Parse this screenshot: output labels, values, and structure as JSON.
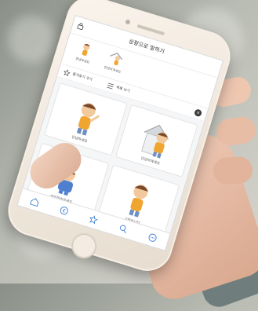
{
  "app": {
    "title": "상황으로 말하기",
    "icons": {
      "lock": "lock-icon",
      "close": "close-icon"
    }
  },
  "favorites": [
    {
      "label": "안녕하세요",
      "icon": "boy-greeting-icon"
    },
    {
      "label": "안녕히계세요",
      "icon": "boy-house-icon"
    }
  ],
  "actions": {
    "add_favorite": "즐겨찾기 추가",
    "view_list": "목록 보기"
  },
  "cards": [
    {
      "label": "안녕하세요",
      "icon": "boy-greeting-icon"
    },
    {
      "label": "안녕히계세요",
      "icon": "boy-house-icon"
    },
    {
      "label": "안녕히주무세요",
      "icon": "boy-sleeping-icon"
    },
    {
      "label": "고맙습니다",
      "icon": "boy-bowing-icon"
    }
  ],
  "tabbar": [
    "home-icon",
    "back-icon",
    "star-icon",
    "search-icon",
    "more-icon"
  ],
  "colors": {
    "accent": "#3f7fd0",
    "phone_body": "#f1e7dc",
    "skin": "#e8c4b0"
  }
}
